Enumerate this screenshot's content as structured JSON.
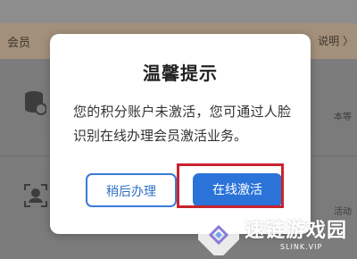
{
  "background": {
    "banner_left": "会员",
    "banner_right": "说明 〉",
    "row1_side_text": "本等",
    "row2_side_text": "活动"
  },
  "dialog": {
    "title": "温馨提示",
    "message": "您的积分账户未激活，您可通过人脸识别在线办理会员激活业务。",
    "later_button": "稍后办理",
    "activate_button": "在线激活"
  },
  "watermark": {
    "brand": "速链游戏园",
    "url": "SLINK.VIP"
  },
  "colors": {
    "primary_button": "#2b73d9",
    "outline_button": "#3a7bd5",
    "highlight": "#c8242f",
    "overlay": "#7c7c7c"
  }
}
